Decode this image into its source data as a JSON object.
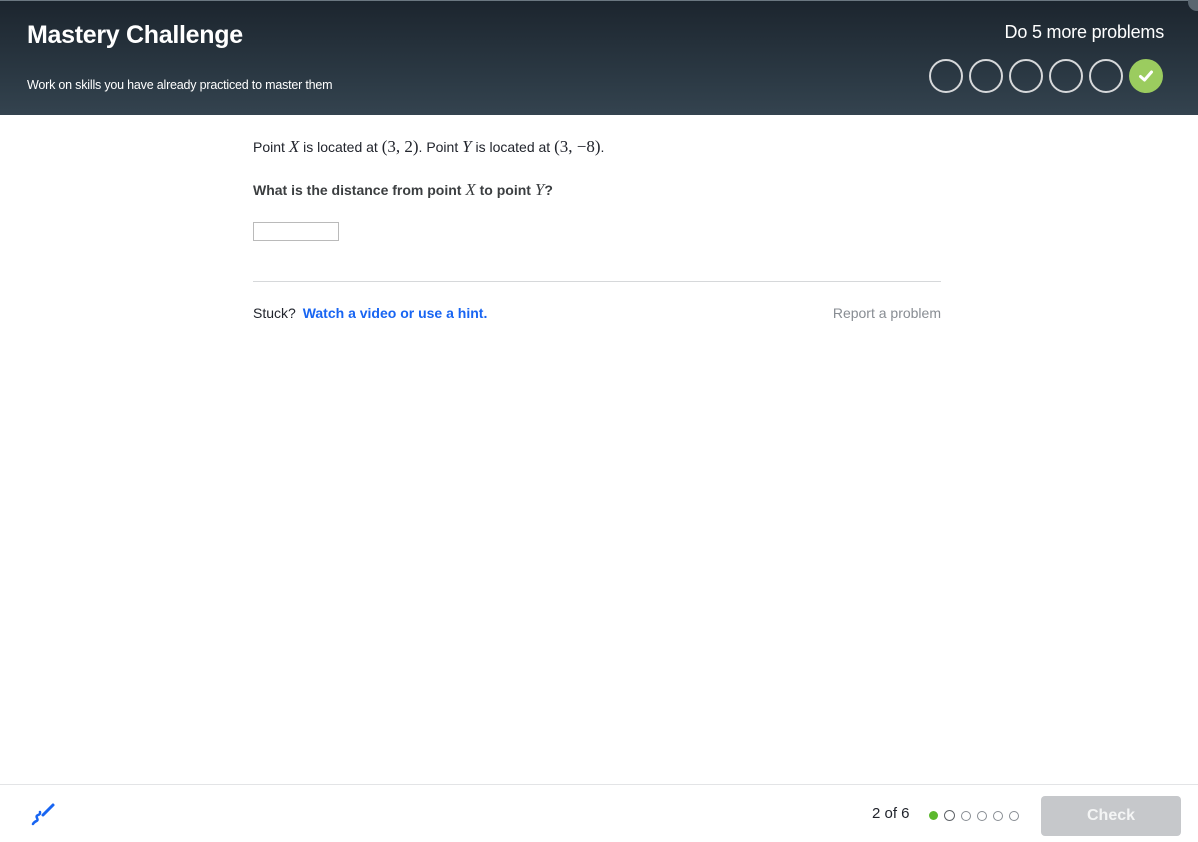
{
  "header": {
    "title": "Mastery Challenge",
    "subtitle": "Work on skills you have already practiced to master them",
    "remaining_text": "Do 5 more problems",
    "mastery_circles": [
      {
        "state": "empty"
      },
      {
        "state": "empty"
      },
      {
        "state": "empty"
      },
      {
        "state": "empty"
      },
      {
        "state": "empty"
      },
      {
        "state": "done",
        "icon": "check-icon"
      }
    ],
    "done_color": "#9bcc5f"
  },
  "problem": {
    "point_label": "Point",
    "located_text": "is located at",
    "point_x_name": "X",
    "point_x_coords": "(3, 2)",
    "point_y_name": "Y",
    "point_y_coords": "(3, −8)",
    "question_prefix": "What is the distance from point",
    "question_middle": "to point",
    "answer_value": ""
  },
  "help": {
    "stuck_label": "Stuck?",
    "hint_link": "Watch a video or use a hint.",
    "report_link": "Report a problem",
    "link_color": "#1865f2"
  },
  "footer": {
    "scratchpad_icon": "scratchpad-pencil-icon",
    "progress_text": "2 of 6",
    "progress_total": 6,
    "progress_completed": 1,
    "progress_current": 2,
    "check_label": "Check",
    "check_enabled": false
  }
}
